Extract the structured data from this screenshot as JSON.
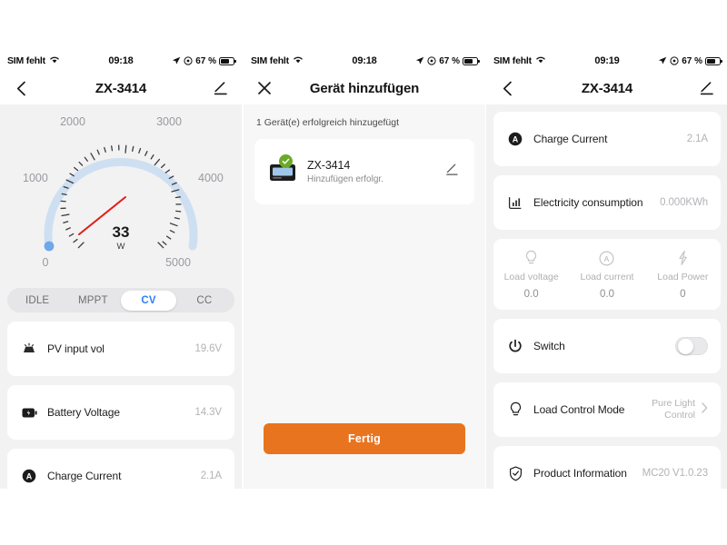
{
  "status_bar": {
    "carrier": "SIM fehlt",
    "time_left": "09:18",
    "time_mid": "09:18",
    "time_right": "09:19",
    "battery_pct": "67 %",
    "icons": [
      "wifi-icon",
      "location-arrow-icon",
      "alarm-icon",
      "battery-icon"
    ]
  },
  "left_panel": {
    "nav": {
      "back": "back-chevron-icon",
      "title": "ZX-3414",
      "edit": "edit-pencil-icon"
    },
    "gauge": {
      "value": "33",
      "unit": "W",
      "ticks": [
        "0",
        "1000",
        "2000",
        "3000",
        "4000",
        "5000"
      ],
      "min": 0,
      "max": 5000,
      "needle_value": 33,
      "arc_color": "#c9dcf2",
      "needle_color": "#e0201b"
    },
    "segments": [
      {
        "label": "IDLE",
        "active": false
      },
      {
        "label": "MPPT",
        "active": false
      },
      {
        "label": "CV",
        "active": true
      },
      {
        "label": "CC",
        "active": false
      }
    ],
    "rows": [
      {
        "icon": "solar-panel-icon",
        "label": "PV input vol",
        "value": "19.6V"
      },
      {
        "icon": "battery-icon",
        "label": "Battery Voltage",
        "value": "14.3V"
      },
      {
        "icon": "charge-current-icon",
        "label": "Charge Current",
        "value": "2.1A"
      }
    ]
  },
  "mid_panel": {
    "nav": {
      "close": "close-x-icon",
      "title": "Gerät hinzufügen"
    },
    "subtitle": "1 Gerät(e) erfolgreich hinzugefügt",
    "device": {
      "thumb": "device-thumbnail-icon",
      "badge": "success-check-icon",
      "name": "ZX-3414",
      "status": "Hinzufügen erfolgr.",
      "edit": "edit-pencil-icon"
    },
    "done_button": "Fertig",
    "accent_color": "#e8741f"
  },
  "right_panel": {
    "nav": {
      "back": "back-chevron-icon",
      "title": "ZX-3414",
      "edit": "edit-pencil-icon"
    },
    "rows": [
      {
        "icon": "charge-current-icon",
        "label": "Charge Current",
        "value": "2.1A"
      },
      {
        "icon": "chart-bars-icon",
        "label": "Electricity consumption",
        "value": "0.000KWh"
      }
    ],
    "load_stats": [
      {
        "icon": "lightbulb-icon",
        "label": "Load voltage",
        "value": "0.0"
      },
      {
        "icon": "ampere-circle-icon",
        "label": "Load current",
        "value": "0.0"
      },
      {
        "icon": "lightning-bolt-icon",
        "label": "Load Power",
        "value": "0"
      }
    ],
    "switch_row": {
      "icon": "power-icon",
      "label": "Switch",
      "state": "off"
    },
    "load_control": {
      "icon": "lightbulb-icon",
      "label": "Load Control Mode",
      "value_line1": "Pure Light",
      "value_line2": "Control",
      "chevron": "chevron-right-icon"
    },
    "product_info": {
      "icon": "shield-check-icon",
      "label": "Product Information",
      "value": "MC20 V1.0.23"
    }
  }
}
